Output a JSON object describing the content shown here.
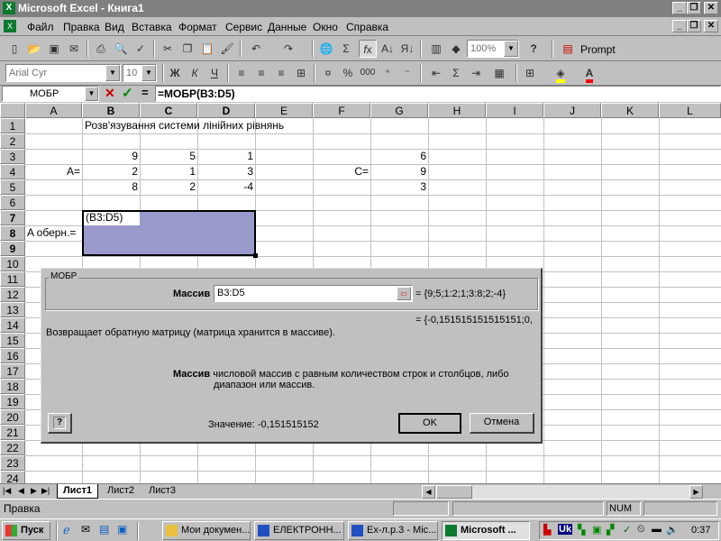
{
  "window": {
    "title": "Microsoft Excel - Книга1",
    "app_icon_label": "X"
  },
  "menu": [
    "Файл",
    "Правка",
    "Вид",
    "Вставка",
    "Формат",
    "Сервис",
    "Данные",
    "Окно",
    "Справка"
  ],
  "toolbar": {
    "zoom": "100%",
    "help": "?",
    "prompt_label": "Prompt"
  },
  "formatting": {
    "font": "Arial Cyr",
    "size": "10",
    "bold": "Ж",
    "italic": "К",
    "underline": "Ч",
    "currency": "000"
  },
  "formula_bar": {
    "name_box": "МОБР",
    "cancel": "✕",
    "enter": "✓",
    "equals": "=",
    "formula": "=МОБР(B3:D5)"
  },
  "columns": [
    "A",
    "B",
    "C",
    "D",
    "E",
    "F",
    "G",
    "H",
    "I",
    "J",
    "K",
    "L"
  ],
  "rows": [
    "1",
    "2",
    "3",
    "4",
    "5",
    "6",
    "7",
    "8",
    "9",
    "10",
    "11",
    "12",
    "13",
    "14",
    "15",
    "16",
    "17",
    "18",
    "19",
    "20",
    "21",
    "22",
    "23",
    "24"
  ],
  "cells": {
    "B1": "Розв'язування системи лінійних рівнянь",
    "B3": "9",
    "C3": "5",
    "D3": "1",
    "G3": "6",
    "A4": "A=",
    "B4": "2",
    "C4": "1",
    "D4": "3",
    "F4": "C=",
    "G4": "9",
    "B5": "8",
    "C5": "2",
    "D5": "-4",
    "G5": "3",
    "B7": "(B3:D5)",
    "A8": "A оберн.="
  },
  "dialog": {
    "group_title": "МОБР",
    "arg_label": "Массив",
    "arg_value": "B3:D5",
    "arg_preview": "= {9;5;1:2;1;3:8;2;-4}",
    "result_preview": "= {-0,151515151515151;0,",
    "description": "Возвращает обратную матрицу (матрица хранится в массиве).",
    "arg_help_bold": "Массив",
    "arg_help_text1": " числовой массив с равным количеством строк и столбцов, либо",
    "arg_help_text2": "диапазон или массив.",
    "value_label": "Значение: -0,151515152",
    "help_button": "?",
    "ok": "OK",
    "cancel": "Отмена"
  },
  "sheets": [
    "Лист1",
    "Лист2",
    "Лист3"
  ],
  "status": {
    "mode": "Правка",
    "num": "NUM"
  },
  "taskbar": {
    "start": "Пуск",
    "tasks": [
      "Мои докумен...",
      "ЕЛЕКТРОНН...",
      "Ex-л.р.3 - Mic...",
      "Microsoft ..."
    ],
    "clock": "0:37",
    "lang": "Uk"
  },
  "colors": {
    "selection": "#9999cc",
    "title_bar": "#808080",
    "excel_green": "#0a7a2e"
  }
}
